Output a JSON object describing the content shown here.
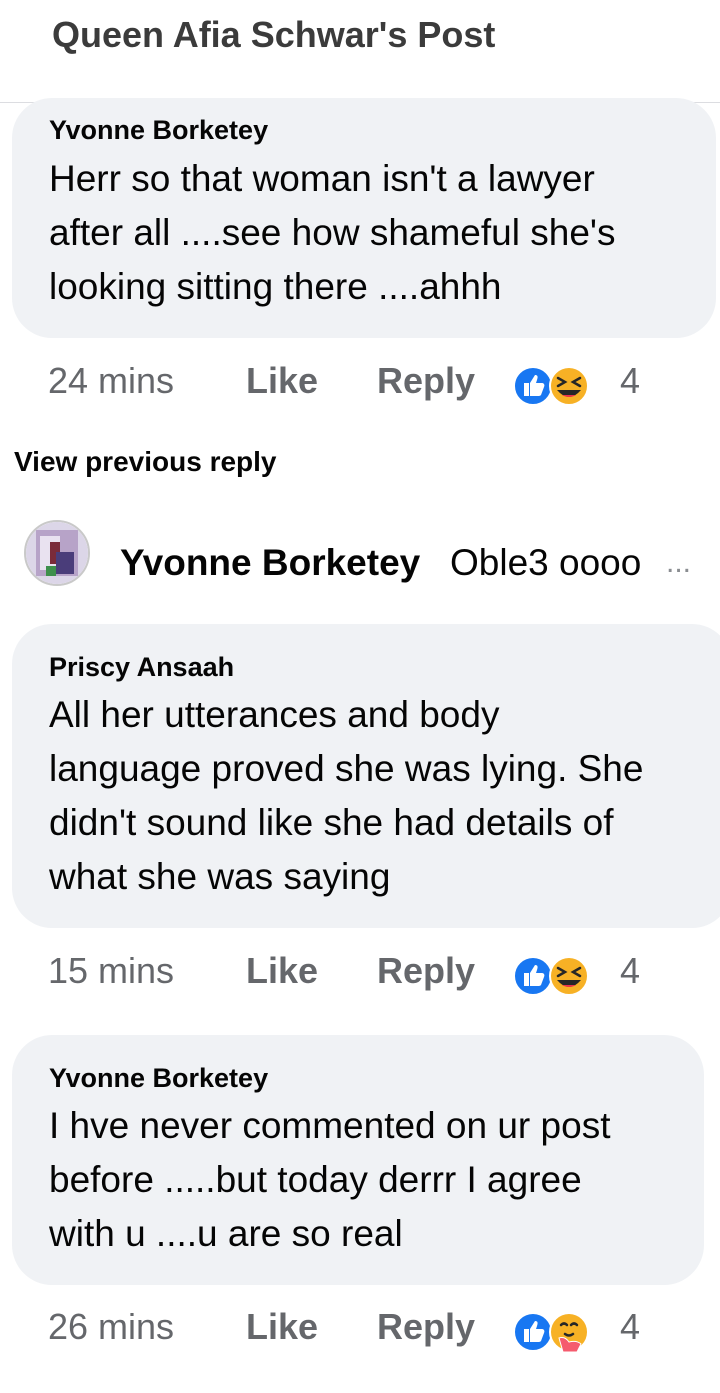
{
  "header": {
    "title": "Queen Afia Schwar's Post"
  },
  "view_previous_label": "View previous reply",
  "comments": [
    {
      "author": "Yvonne Borketey",
      "lines": [
        "Herr so that woman isn't a lawyer",
        "after all ....see how shameful she's",
        "looking sitting there ....ahhh"
      ],
      "time": "24 mins",
      "like_label": "Like",
      "reply_label": "Reply",
      "reaction_count": "4",
      "reactions": [
        "like-icon",
        "laughing-face-icon"
      ]
    },
    {
      "author": "Priscy Ansaah",
      "lines": [
        "All her utterances and body",
        "language proved she was lying. She",
        "didn't sound like she had details of",
        "what she was saying"
      ],
      "time": "15 mins",
      "like_label": "Like",
      "reply_label": "Reply",
      "reaction_count": "4",
      "reactions": [
        "like-icon",
        "laughing-face-icon"
      ]
    },
    {
      "author": "Yvonne Borketey",
      "lines": [
        "I hve never commented on ur post",
        "before .....but today  derrr I agree",
        "with u ....u are so real"
      ],
      "time": "26 mins",
      "like_label": "Like",
      "reply_label": "Reply",
      "reaction_count": "4",
      "reactions": [
        "like-icon",
        "care-hug-face-icon"
      ]
    }
  ],
  "reply_preview": {
    "name": "Yvonne Borketey",
    "text": "Oble3 oooo",
    "more": "..."
  },
  "colors": {
    "bubble": "#f0f2f5",
    "meta": "#65676b",
    "like_blue": "#1877f2",
    "emoji_yellow": "#f7b125"
  }
}
